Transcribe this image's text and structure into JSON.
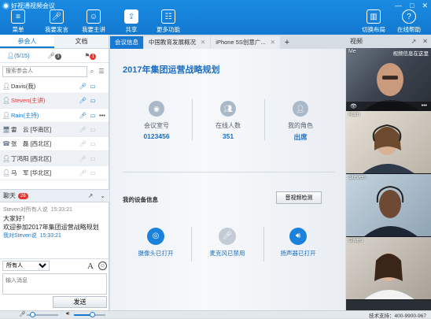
{
  "app": {
    "title": "好视通视频会议"
  },
  "toolbar": {
    "menu": "菜单",
    "speak": "我要发言",
    "host": "我要主讲",
    "share": "共享",
    "more": "更多功能",
    "layout": "切换布局",
    "help": "在线帮助"
  },
  "left_tabs": {
    "participants": "参会人",
    "docs": "文档"
  },
  "filter": {
    "count": "(5/15)",
    "mic_badge": "3",
    "flag_badge": "1"
  },
  "search": {
    "placeholder": "搜索参会人"
  },
  "participants": [
    {
      "name": "Davis(我)",
      "role": "normal"
    },
    {
      "name": "Steven(主讲)",
      "role": "host"
    },
    {
      "name": "Rain(主持)",
      "role": "chair"
    },
    {
      "name": "雷　云 [华南区]",
      "role": "normal"
    },
    {
      "name": "张　磊 [西北区]",
      "role": "normal"
    },
    {
      "name": "丁鸿阳 [西北区]",
      "role": "normal"
    },
    {
      "name": "马　军 [华北区]",
      "role": "normal"
    }
  ],
  "chat": {
    "title": "聊天",
    "badge": "26",
    "meta1": "Steven对所有人说",
    "time1": "15:33:21",
    "line1": "大家好！",
    "line2": "欢迎参加2017年集团运营战略规划",
    "meta2": "我对Steven说",
    "time2": "15:33:21",
    "target": "所有人",
    "input_placeholder": "输入消息",
    "send": "发送"
  },
  "center": {
    "tabs": [
      "会议信息",
      "中国教育发展概况",
      "iPhone 5S创意广..."
    ],
    "add": "+",
    "meeting_title": "2017年集团运营战略规划",
    "room_label": "会议室号",
    "room_value": "0123456",
    "online_label": "在线人数",
    "online_value": "351",
    "role_label": "我的角色",
    "role_value": "出席",
    "device_title": "我的设备信息",
    "av_test": "音视频检测",
    "camera": "摄像头已打开",
    "mic": "麦克风已禁用",
    "speaker": "扬声器已打开"
  },
  "videos": {
    "header": "视频",
    "items": [
      {
        "name": "Me",
        "tag": "视频信息在这里"
      },
      {
        "name": "Rain",
        "tag": ""
      },
      {
        "name": "Steven",
        "tag": ""
      },
      {
        "name": "Given",
        "tag": ""
      }
    ]
  },
  "status": {
    "support": "技术支持：400-9900-967"
  },
  "colors": {
    "accent": "#1779d1",
    "host": "#e5352e"
  }
}
